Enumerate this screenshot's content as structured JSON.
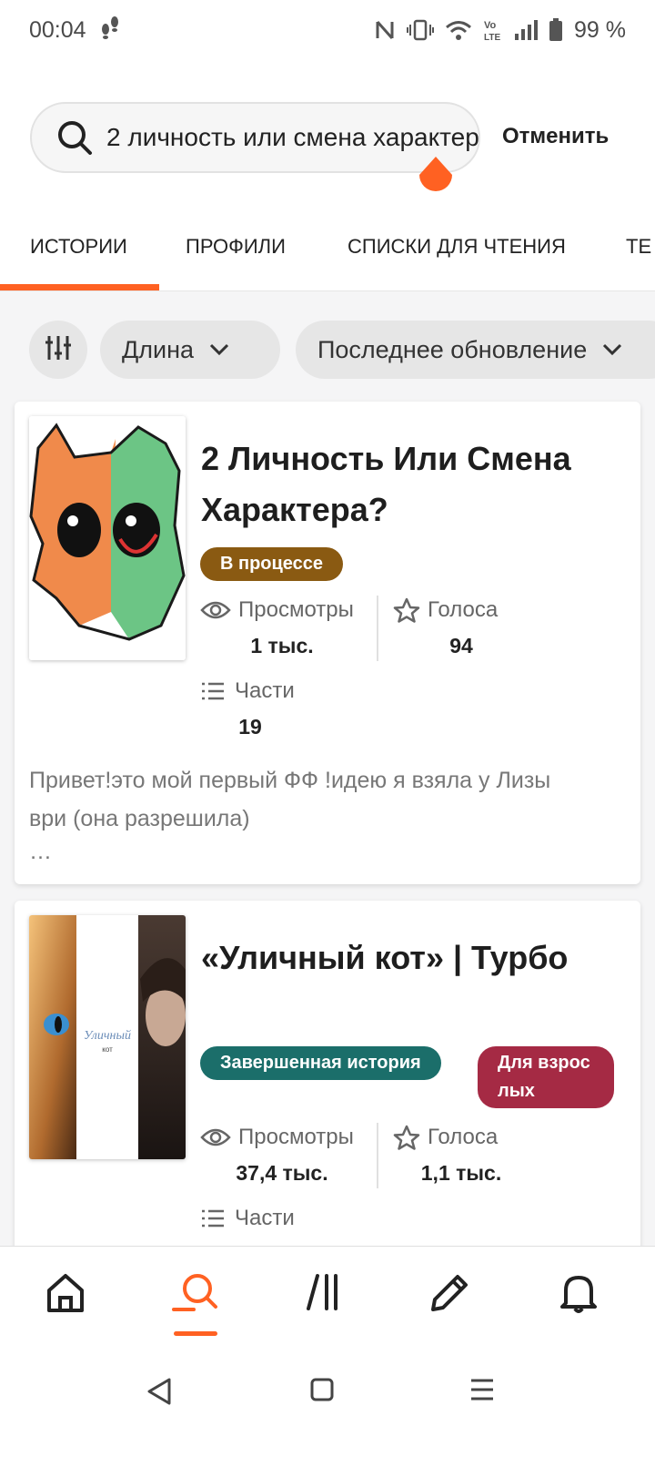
{
  "status_bar": {
    "time": "00:04",
    "battery": "99 %"
  },
  "search": {
    "query": "2 личность или смена характера",
    "cancel_label": "Отменить"
  },
  "tabs": [
    "ИСТОРИИ",
    "ПРОФИЛИ",
    "СПИСКИ ДЛЯ ЧТЕНИЯ",
    "ТЕ"
  ],
  "filters": {
    "length_label": "Длина",
    "updated_label": "Последнее обновление"
  },
  "stories": [
    {
      "title": "2 Личность Или Смена Характера?",
      "status_badge": "В процессе",
      "views_label": "Просмотры",
      "views_value": "1 тыс.",
      "votes_label": "Голоса",
      "votes_value": "94",
      "parts_label": "Части",
      "parts_value": "19",
      "description": "Привет!это мой первый ФФ !идею я взяла у Лизы ври (она разрешила)",
      "ellipsis": "…"
    },
    {
      "title": "«Уличный кот» | Турбо",
      "status_badge": "Завершенная история",
      "mature_badge": "Для взрослых",
      "cover_text_1": "Уличный",
      "cover_text_2": "кот",
      "views_label": "Просмотры",
      "views_value": "37,4 тыс.",
      "votes_label": "Голоса",
      "votes_value": "1,1 тыс.",
      "parts_label": "Части"
    }
  ],
  "bottom_nav": [
    "home-icon",
    "search-icon",
    "library-icon",
    "write-icon",
    "notifications-icon"
  ],
  "colors": {
    "accent": "#ff6122",
    "in_progress": "#8a5a12",
    "completed": "#1b6e6a",
    "mature": "#a52a44"
  }
}
